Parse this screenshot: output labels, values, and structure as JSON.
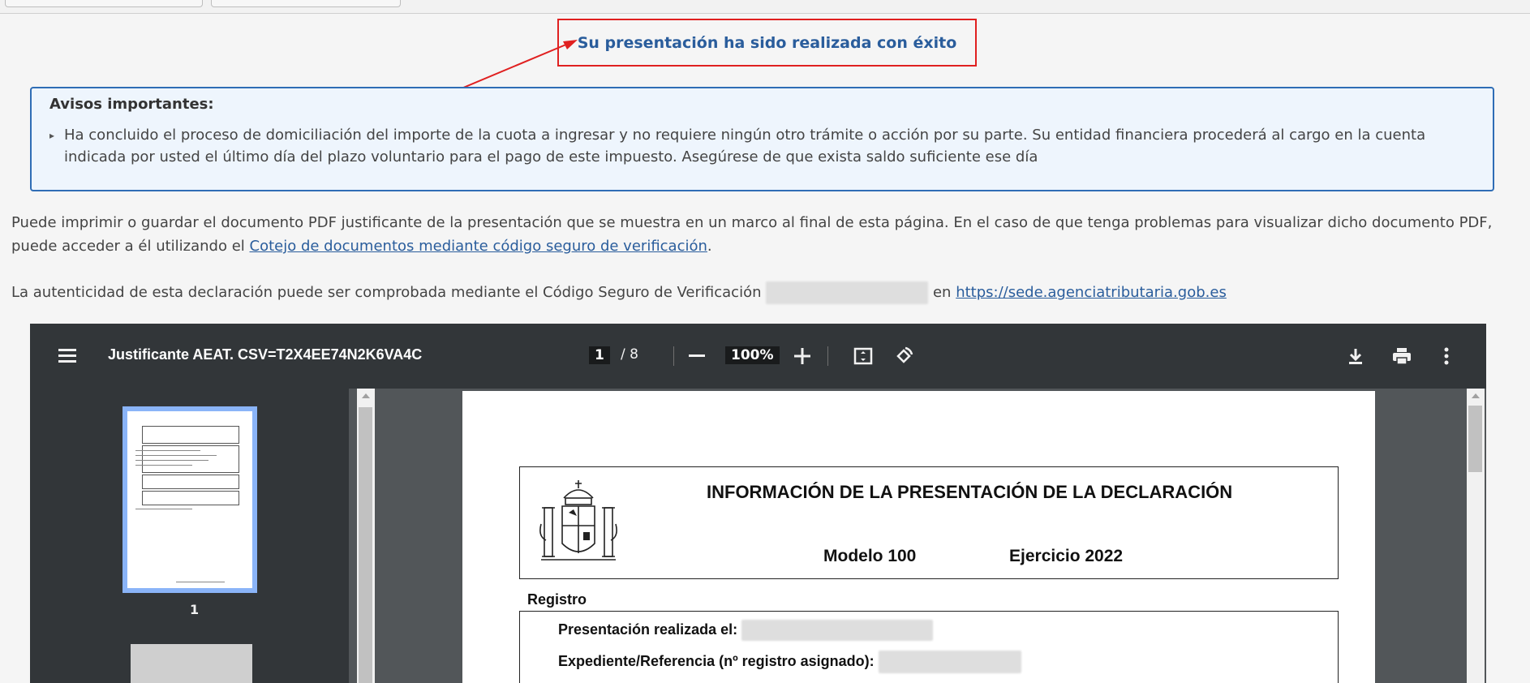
{
  "success": {
    "message": "Su presentación ha sido realizada con éxito"
  },
  "notice": {
    "title": "Avisos importantes:",
    "item": "Ha concluido el proceso de domiciliación del importe de la cuota a ingresar y no requiere ningún otro trámite o acción por su parte. Su entidad financiera procederá al cargo en la cuenta indicada por usted el último día del plazo voluntario para el pago de este impuesto. Asegúrese de que exista saldo suficiente ese día"
  },
  "print_paragraph": {
    "before": "Puede imprimir o guardar el documento PDF justificante de la presentación que se muestra en un marco al final de esta página. En el caso de que tenga problemas para visualizar dicho documento PDF, puede acceder a él utilizando el ",
    "link": "Cotejo de documentos mediante código seguro de verificación",
    "after": "."
  },
  "auth_paragraph": {
    "before": "La autenticidad de esta declaración puede ser comprobada mediante el Código Seguro de Verificación",
    "middle": "en",
    "link": "https://sede.agenciatributaria.gob.es"
  },
  "viewer": {
    "title": "Justificante AEAT. CSV=T2X4EE74N2K6VA4C",
    "current_page": "1",
    "page_separator": "/ 8",
    "zoom": "100%",
    "thumbnail_label": "1",
    "icons": [
      "menu-icon",
      "zoom-out-icon",
      "zoom-in-icon",
      "fit-page-icon",
      "rotate-icon",
      "download-icon",
      "print-icon",
      "more-options-icon"
    ]
  },
  "pdf": {
    "title": "INFORMACIÓN DE LA PRESENTACIÓN DE LA DECLARACIÓN",
    "modelo": "Modelo 100",
    "ejercicio": "Ejercicio 2022",
    "registro_label": "Registro",
    "row1": "Presentación realizada el:",
    "row2": "Expediente/Referencia (nº registro asignado):"
  },
  "colors": {
    "annotation": "#e02020",
    "link": "#2a5d9c",
    "notice_border": "#2f6db5",
    "viewer_toolbar": "#323639"
  }
}
